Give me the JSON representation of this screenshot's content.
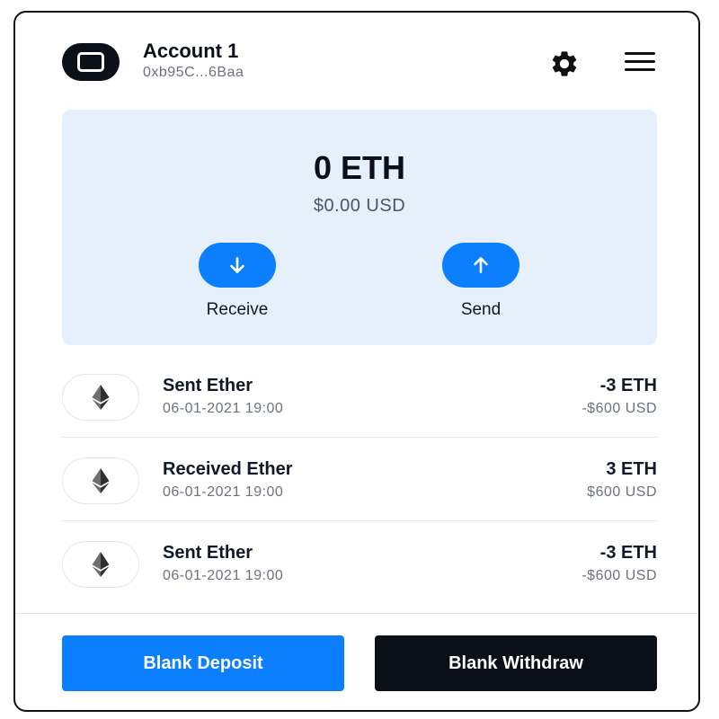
{
  "header": {
    "account_name": "Account 1",
    "account_address": "0xb95C...6Baa"
  },
  "balance": {
    "amount": "0 ETH",
    "usd": "$0.00 USD",
    "actions": {
      "receive_label": "Receive",
      "send_label": "Send"
    }
  },
  "transactions": [
    {
      "title": "Sent Ether",
      "date": "06-01-2021 19:00",
      "amount": "-3 ETH",
      "usd": "-$600 USD"
    },
    {
      "title": "Received Ether",
      "date": "06-01-2021 19:00",
      "amount": "3 ETH",
      "usd": "$600 USD"
    },
    {
      "title": "Sent Ether",
      "date": "06-01-2021 19:00",
      "amount": "-3 ETH",
      "usd": "-$600 USD"
    }
  ],
  "footer": {
    "deposit_label": "Blank Deposit",
    "withdraw_label": "Blank Withdraw"
  },
  "colors": {
    "accent": "#0b7ffd",
    "dark": "#0b0f17",
    "card_bg": "#e6f0fb"
  },
  "icons": [
    "account-avatar-icon",
    "gear-icon",
    "hamburger-menu-icon",
    "arrow-down-icon",
    "arrow-up-icon",
    "ethereum-icon"
  ]
}
